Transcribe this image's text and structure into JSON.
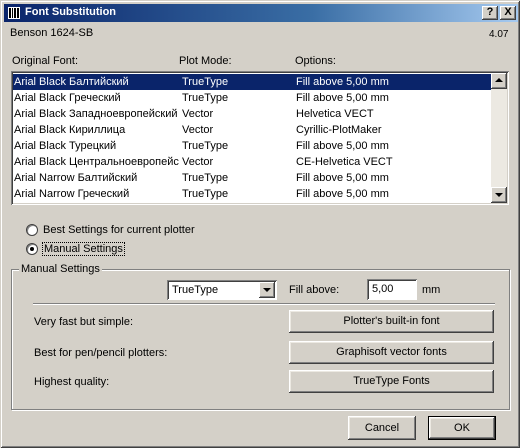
{
  "window": {
    "title": "Font Substitution",
    "help_button": "?",
    "close_button": "X"
  },
  "header": {
    "font_name": "Benson 1624-SB",
    "version": "4.07"
  },
  "columns": {
    "original_font": "Original Font:",
    "plot_mode": "Plot Mode:",
    "options": "Options:"
  },
  "rows": [
    {
      "font": "Arial Black Балтийский",
      "mode": "TrueType",
      "option": "Fill above 5,00 mm",
      "selected": true
    },
    {
      "font": "Arial Black Греческий",
      "mode": "TrueType",
      "option": "Fill above 5,00 mm"
    },
    {
      "font": "Arial Black Западноевропейский",
      "mode": "Vector",
      "option": "Helvetica VECT"
    },
    {
      "font": "Arial Black Кириллица",
      "mode": "Vector",
      "option": "Cyrillic-PlotMaker"
    },
    {
      "font": "Arial Black Турецкий",
      "mode": "TrueType",
      "option": "Fill above 5,00 mm"
    },
    {
      "font": "Arial Black Центральноевропейский",
      "mode": "Vector",
      "option": "CE-Helvetica VECT"
    },
    {
      "font": "Arial Narrow Балтийский",
      "mode": "TrueType",
      "option": "Fill above 5,00 mm"
    },
    {
      "font": "Arial Narrow Греческий",
      "mode": "TrueType",
      "option": "Fill above 5,00 mm"
    }
  ],
  "radios": {
    "best_settings": "Best Settings for current plotter",
    "manual_settings": "Manual Settings",
    "selected": "manual_settings"
  },
  "manual": {
    "group_title": "Manual Settings",
    "plot_mode_value": "TrueType",
    "fill_above_label": "Fill above:",
    "fill_above_value": "5,00",
    "unit": "mm",
    "desc_fast": "Very fast but simple:",
    "desc_pen": "Best for pen/pencil plotters:",
    "desc_quality": "Highest quality:",
    "btn_builtin": "Plotter's built-in font",
    "btn_vector": "Graphisoft vector fonts",
    "btn_truetype": "TrueType Fonts"
  },
  "footer": {
    "cancel": "Cancel",
    "ok": "OK"
  }
}
